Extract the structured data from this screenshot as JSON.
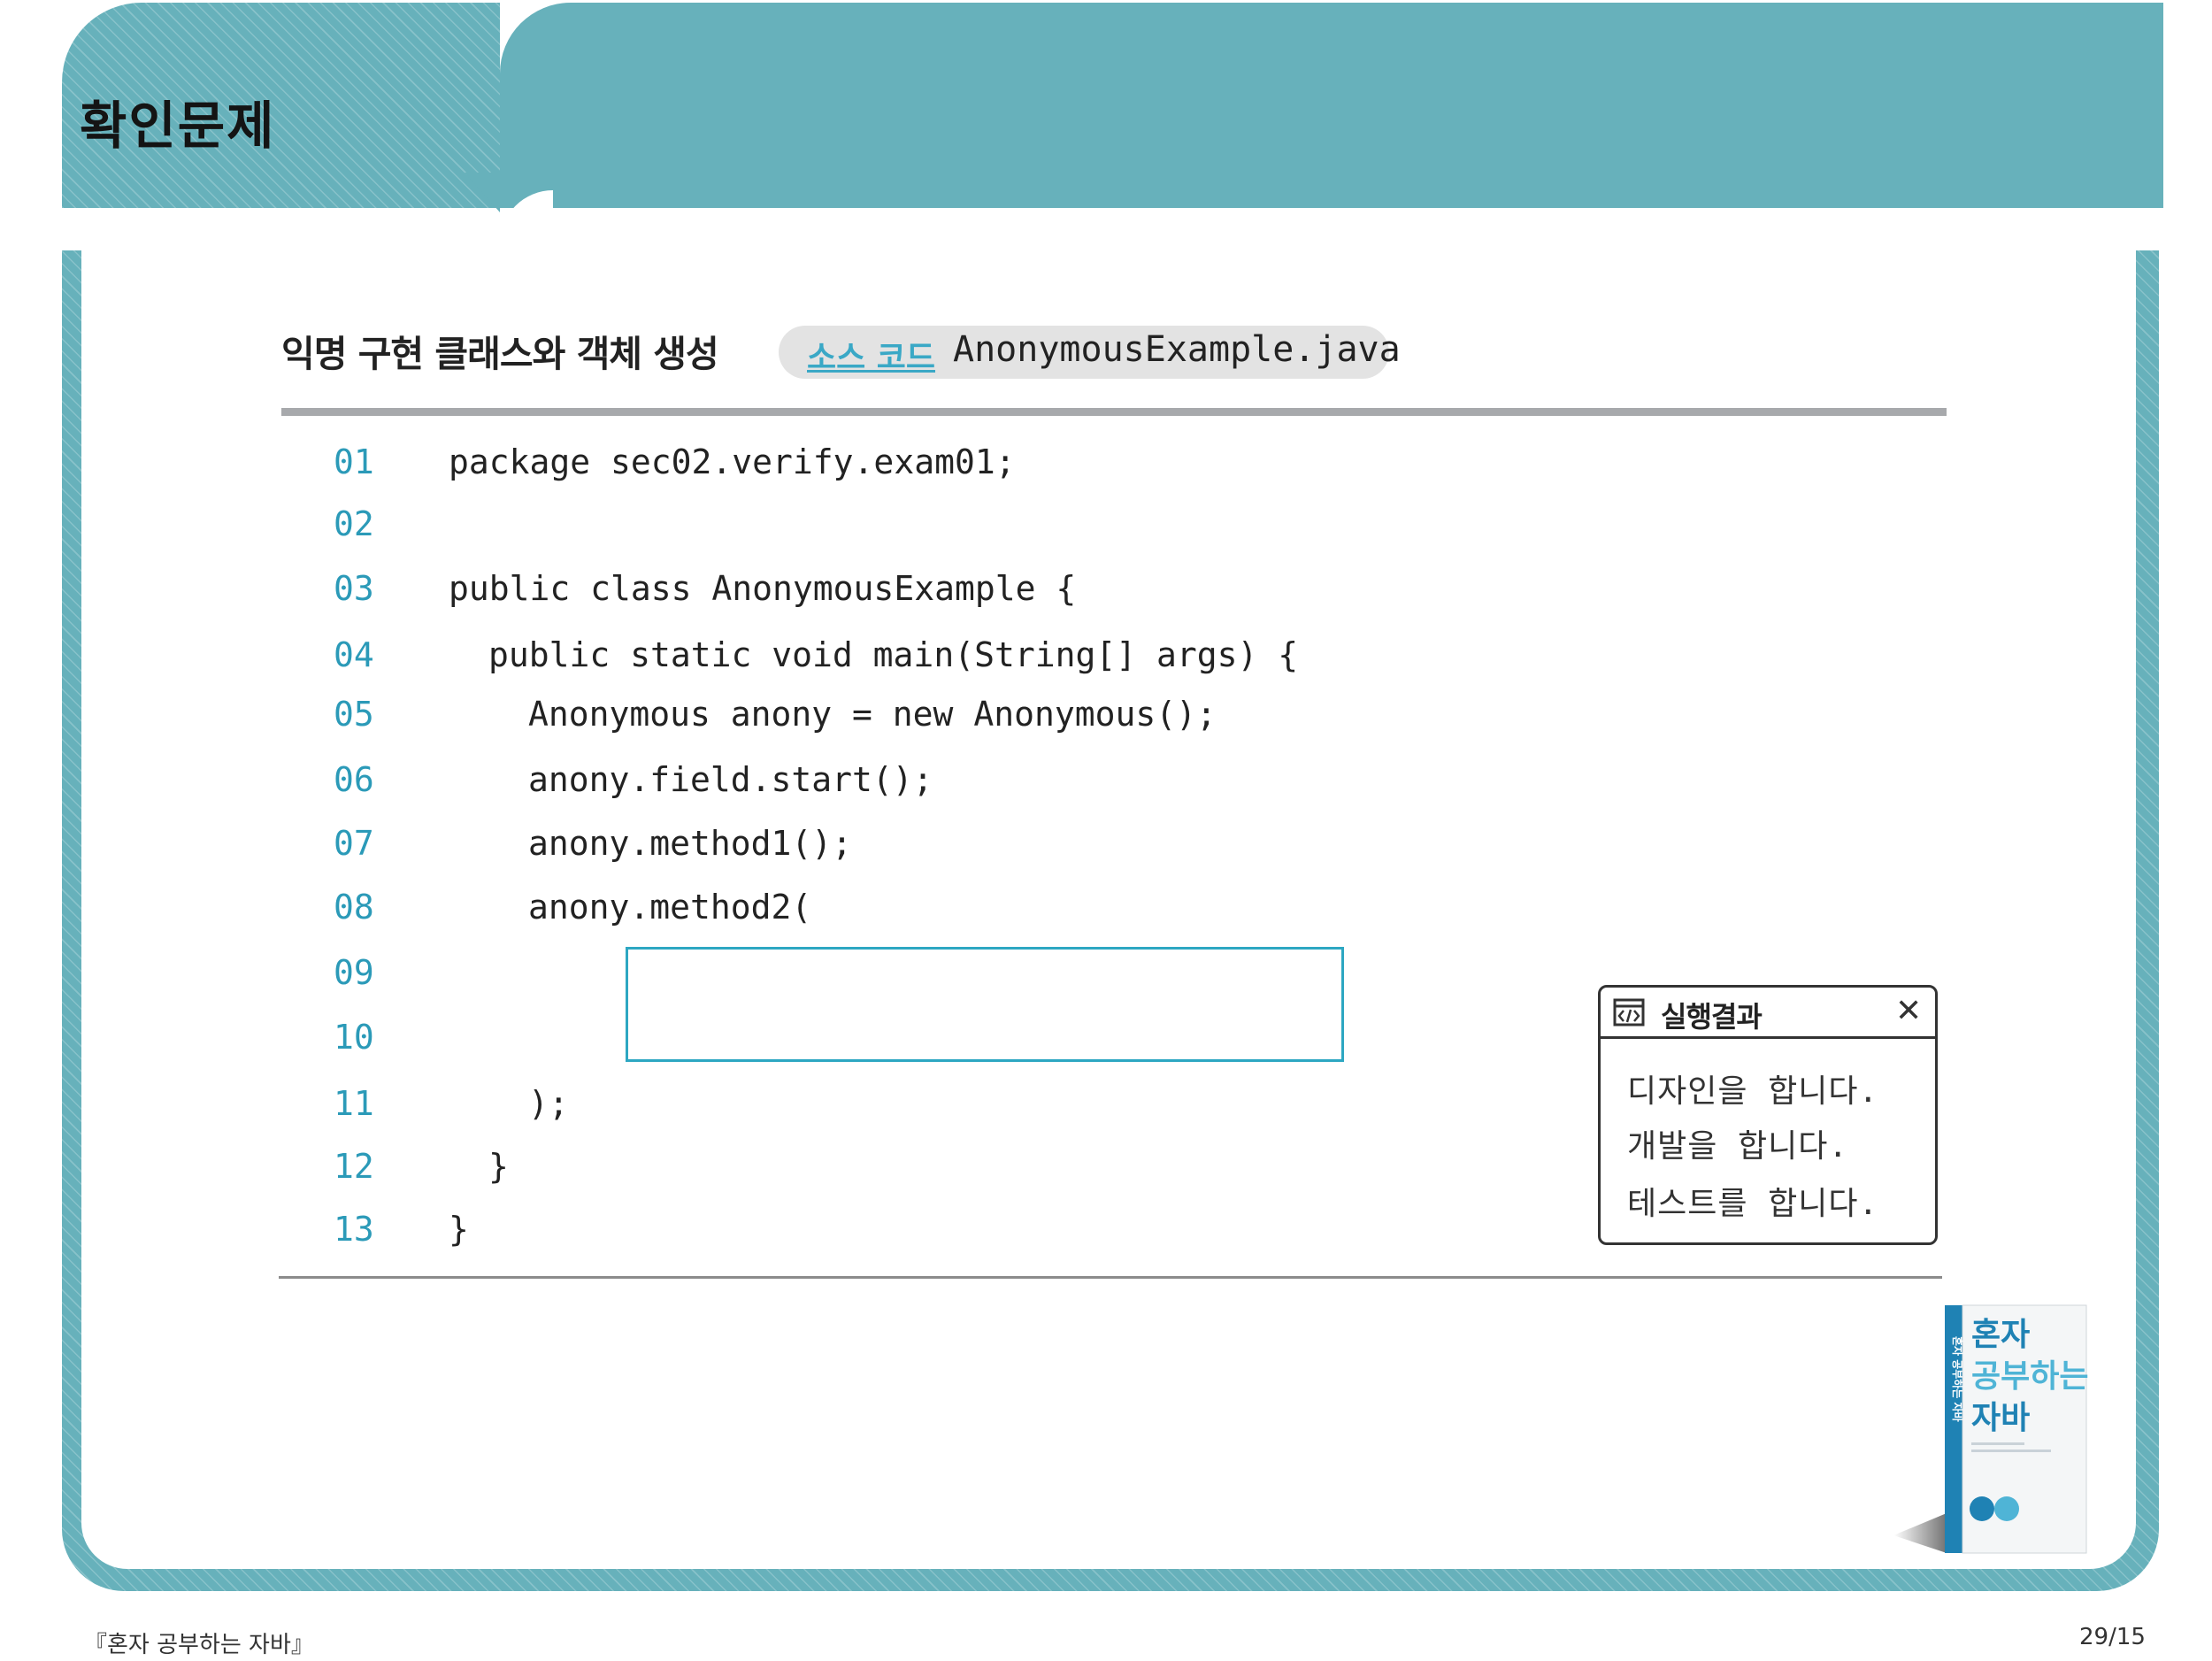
{
  "header": {
    "title": "확인문제"
  },
  "example": {
    "title": "익명 구현 클래스와 객체 생성",
    "source_label": "소스 코드",
    "filename": "AnonymousExample.java"
  },
  "code_lines": [
    {
      "num": "01",
      "text": "package sec02.verify.exam01;"
    },
    {
      "num": "02",
      "text": ""
    },
    {
      "num": "03",
      "text": "public class AnonymousExample {"
    },
    {
      "num": "04",
      "text": "public static void main(String[] args) {"
    },
    {
      "num": "05",
      "text": "Anonymous anony = new Anonymous();"
    },
    {
      "num": "06",
      "text": "anony.field.start();"
    },
    {
      "num": "07",
      "text": "anony.method1();"
    },
    {
      "num": "08",
      "text": "anony.method2("
    },
    {
      "num": "09",
      "text": ""
    },
    {
      "num": "10",
      "text": ""
    },
    {
      "num": "11",
      "text": ");"
    },
    {
      "num": "12",
      "text": "}"
    },
    {
      "num": "13",
      "text": "}"
    }
  ],
  "result_panel": {
    "title": "실행결과",
    "close_symbol": "✕",
    "lines": [
      "디자인을 합니다.",
      "개발을 합니다.",
      "테스트를 합니다."
    ]
  },
  "book": {
    "title_lines": [
      "혼자",
      "공부하는",
      "자바"
    ],
    "spine_text": "혼자 공부하는 자바"
  },
  "footer": {
    "book_title": "『혼자 공부하는 자바』",
    "page": "29/15"
  },
  "colors": {
    "header_teal": "#67b1bb",
    "line_number_blue": "#2b9ab8",
    "answer_box": "#2da7c2",
    "source_label": "#3aa8c6"
  }
}
